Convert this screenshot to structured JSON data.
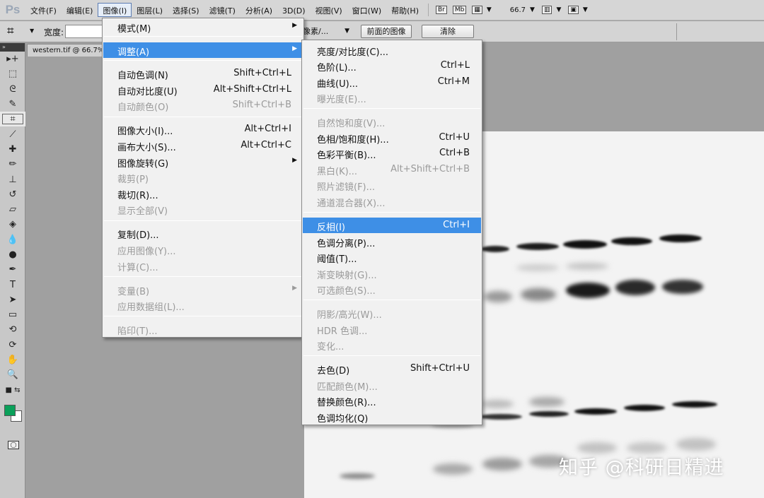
{
  "menubar": {
    "logo": "Ps",
    "items": [
      "文件(F)",
      "编辑(E)",
      "图像(I)",
      "图层(L)",
      "选择(S)",
      "滤镜(T)",
      "分析(A)",
      "3D(D)",
      "视图(V)",
      "窗口(W)",
      "帮助(H)"
    ],
    "bridge_label": "Br",
    "minibridge_label": "Mb",
    "zoom_value": "66.7"
  },
  "options_bar": {
    "width_label": "宽度:",
    "unit_value": "像素/...",
    "front_image_button": "前面的图像",
    "clear_button": "清除"
  },
  "document": {
    "tab_title": "western.tif @ 66.7%"
  },
  "image_menu": {
    "rows": [
      {
        "label": "模式(M)",
        "shortcut": "",
        "submenu": true,
        "disabled": false,
        "highlighted": false
      },
      {
        "label": "调整(A)",
        "shortcut": "",
        "submenu": true,
        "disabled": false,
        "highlighted": true
      },
      {
        "label": "自动色调(N)",
        "shortcut": "Shift+Ctrl+L",
        "submenu": false,
        "disabled": false,
        "highlighted": false
      },
      {
        "label": "自动对比度(U)",
        "shortcut": "Alt+Shift+Ctrl+L",
        "submenu": false,
        "disabled": false,
        "highlighted": false
      },
      {
        "label": "自动颜色(O)",
        "shortcut": "Shift+Ctrl+B",
        "submenu": false,
        "disabled": true,
        "highlighted": false
      },
      {
        "label": "图像大小(I)...",
        "shortcut": "Alt+Ctrl+I",
        "submenu": false,
        "disabled": false,
        "highlighted": false
      },
      {
        "label": "画布大小(S)...",
        "shortcut": "Alt+Ctrl+C",
        "submenu": false,
        "disabled": false,
        "highlighted": false
      },
      {
        "label": "图像旋转(G)",
        "shortcut": "",
        "submenu": true,
        "disabled": false,
        "highlighted": false
      },
      {
        "label": "裁剪(P)",
        "shortcut": "",
        "submenu": false,
        "disabled": true,
        "highlighted": false
      },
      {
        "label": "裁切(R)...",
        "shortcut": "",
        "submenu": false,
        "disabled": false,
        "highlighted": false
      },
      {
        "label": "显示全部(V)",
        "shortcut": "",
        "submenu": false,
        "disabled": true,
        "highlighted": false
      },
      {
        "label": "复制(D)...",
        "shortcut": "",
        "submenu": false,
        "disabled": false,
        "highlighted": false
      },
      {
        "label": "应用图像(Y)...",
        "shortcut": "",
        "submenu": false,
        "disabled": true,
        "highlighted": false
      },
      {
        "label": "计算(C)...",
        "shortcut": "",
        "submenu": false,
        "disabled": true,
        "highlighted": false
      },
      {
        "label": "变量(B)",
        "shortcut": "",
        "submenu": true,
        "disabled": true,
        "highlighted": false
      },
      {
        "label": "应用数据组(L)...",
        "shortcut": "",
        "submenu": false,
        "disabled": true,
        "highlighted": false
      },
      {
        "label": "陷印(T)...",
        "shortcut": "",
        "submenu": false,
        "disabled": true,
        "highlighted": false
      }
    ]
  },
  "adjust_menu": {
    "rows": [
      {
        "label": "亮度/对比度(C)...",
        "shortcut": "",
        "disabled": false,
        "highlighted": false
      },
      {
        "label": "色阶(L)...",
        "shortcut": "Ctrl+L",
        "disabled": false,
        "highlighted": false
      },
      {
        "label": "曲线(U)...",
        "shortcut": "Ctrl+M",
        "disabled": false,
        "highlighted": false
      },
      {
        "label": "曝光度(E)...",
        "shortcut": "",
        "disabled": true,
        "highlighted": false
      },
      {
        "label": "自然饱和度(V)...",
        "shortcut": "",
        "disabled": true,
        "highlighted": false
      },
      {
        "label": "色相/饱和度(H)...",
        "shortcut": "Ctrl+U",
        "disabled": false,
        "highlighted": false
      },
      {
        "label": "色彩平衡(B)...",
        "shortcut": "Ctrl+B",
        "disabled": false,
        "highlighted": false
      },
      {
        "label": "黑白(K)...",
        "shortcut": "Alt+Shift+Ctrl+B",
        "disabled": true,
        "highlighted": false
      },
      {
        "label": "照片滤镜(F)...",
        "shortcut": "",
        "disabled": true,
        "highlighted": false
      },
      {
        "label": "通道混合器(X)...",
        "shortcut": "",
        "disabled": true,
        "highlighted": false
      },
      {
        "label": "反相(I)",
        "shortcut": "Ctrl+I",
        "disabled": false,
        "highlighted": true
      },
      {
        "label": "色调分离(P)...",
        "shortcut": "",
        "disabled": false,
        "highlighted": false
      },
      {
        "label": "阈值(T)...",
        "shortcut": "",
        "disabled": false,
        "highlighted": false
      },
      {
        "label": "渐变映射(G)...",
        "shortcut": "",
        "disabled": true,
        "highlighted": false
      },
      {
        "label": "可选颜色(S)...",
        "shortcut": "",
        "disabled": true,
        "highlighted": false
      },
      {
        "label": "阴影/高光(W)...",
        "shortcut": "",
        "disabled": true,
        "highlighted": false
      },
      {
        "label": "HDR 色调...",
        "shortcut": "",
        "disabled": true,
        "highlighted": false
      },
      {
        "label": "变化...",
        "shortcut": "",
        "disabled": true,
        "highlighted": false
      },
      {
        "label": "去色(D)",
        "shortcut": "Shift+Ctrl+U",
        "disabled": false,
        "highlighted": false
      },
      {
        "label": "匹配颜色(M)...",
        "shortcut": "",
        "disabled": true,
        "highlighted": false
      },
      {
        "label": "替换颜色(R)...",
        "shortcut": "",
        "disabled": false,
        "highlighted": false
      },
      {
        "label": "色调均化(Q)",
        "shortcut": "",
        "disabled": false,
        "highlighted": false
      }
    ]
  },
  "toolbox": {
    "tools": [
      "move-tool-icon",
      "marquee-tool-icon",
      "lasso-tool-icon",
      "quick-selection-icon",
      "crop-tool-icon",
      "eyedropper-icon",
      "healing-brush-icon",
      "brush-icon",
      "clone-stamp-icon",
      "history-brush-icon",
      "eraser-icon",
      "paint-bucket-icon",
      "blur-icon",
      "dodge-icon",
      "pen-tool-icon",
      "type-tool-icon",
      "path-selection-icon",
      "shape-tool-icon",
      "3d-rotate-icon",
      "3d-orbit-icon",
      "hand-tool-icon",
      "zoom-tool-icon"
    ],
    "foreground_color": "#0aa05a",
    "background_color": "#ffffff"
  },
  "watermark": "知乎 @科研日精进",
  "colors": {
    "highlight": "#3e8fe6",
    "menu_bg": "#f1f1f1",
    "workspace_bg": "#a0a0a0"
  }
}
